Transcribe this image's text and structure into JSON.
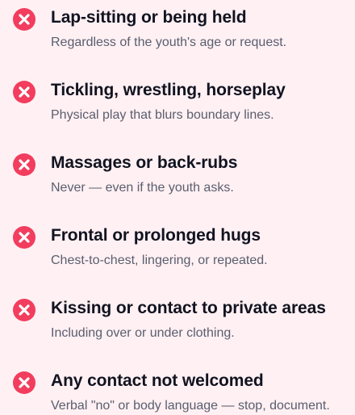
{
  "icon_color": "#f23d5e",
  "items": [
    {
      "icon": "x-circle-icon",
      "title": "Lap-sitting or being held",
      "description": "Regardless of the youth's age or request."
    },
    {
      "icon": "x-circle-icon",
      "title": "Tickling, wrestling, horseplay",
      "description": "Physical play that blurs boundary lines."
    },
    {
      "icon": "x-circle-icon",
      "title": "Massages or back-rubs",
      "description": "Never — even if the youth asks."
    },
    {
      "icon": "x-circle-icon",
      "title": "Frontal or prolonged hugs",
      "description": "Chest-to-chest, lingering, or repeated."
    },
    {
      "icon": "x-circle-icon",
      "title": "Kissing or contact to private areas",
      "description": "Including over or under clothing."
    },
    {
      "icon": "x-circle-icon",
      "title": "Any contact not welcomed",
      "description": "Verbal \"no\" or body language — stop, document."
    }
  ]
}
